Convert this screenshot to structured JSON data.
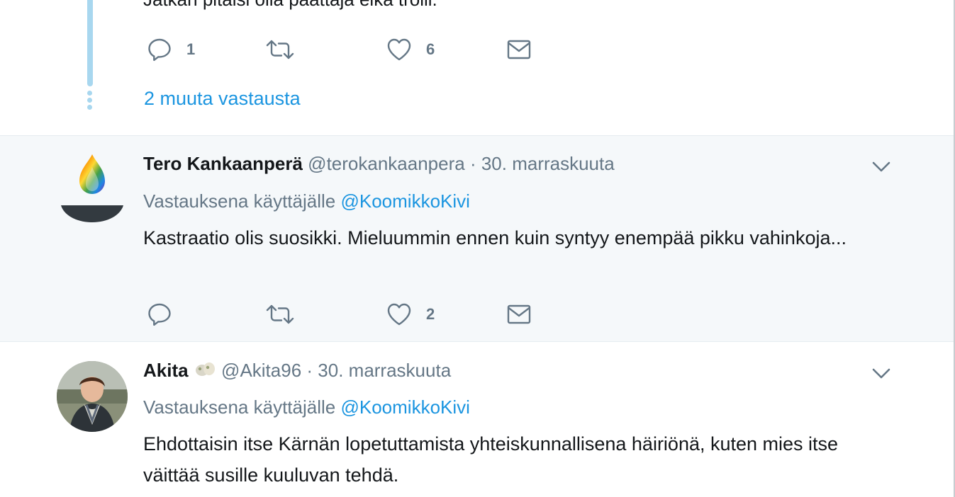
{
  "top_tweet": {
    "text": "Jätkän pitäisi olla päättäjä eikä trolli.",
    "reply_count": "1",
    "retweet_count": "",
    "like_count": "6",
    "more_replies_label": "2 muuta vastausta"
  },
  "tweets": [
    {
      "name": "Tero Kankaanperä",
      "handle": "@terokankaanpera",
      "date": "· 30. marraskuuta",
      "reply_prefix": "Vastauksena käyttäjälle",
      "reply_to": "@KoomikkoKivi",
      "text": "Kastraatio olis suosikki. Mieluummin ennen kuin syntyy enempää pikku vahinkoja...",
      "reply_count": "",
      "like_count": "2"
    },
    {
      "name": "Akita",
      "handle": "@Akita96",
      "date": "· 30. marraskuuta",
      "reply_prefix": "Vastauksena käyttäjälle",
      "reply_to": "@KoomikkoKivi",
      "text": "Ehdottaisin itse Kärnän lopetuttamista yhteiskunnallisena häiriönä, kuten mies itse väittää susille kuuluvan tehdä."
    }
  ],
  "icons": {
    "reply": "reply-icon",
    "retweet": "retweet-icon",
    "like": "heart-icon",
    "dm": "envelope-icon",
    "more": "chevron-down-icon"
  },
  "colors": {
    "link": "#1b95e0",
    "thread_line": "#a8d7ef",
    "muted": "#657786",
    "highlight_bg": "#f5f8fa"
  }
}
